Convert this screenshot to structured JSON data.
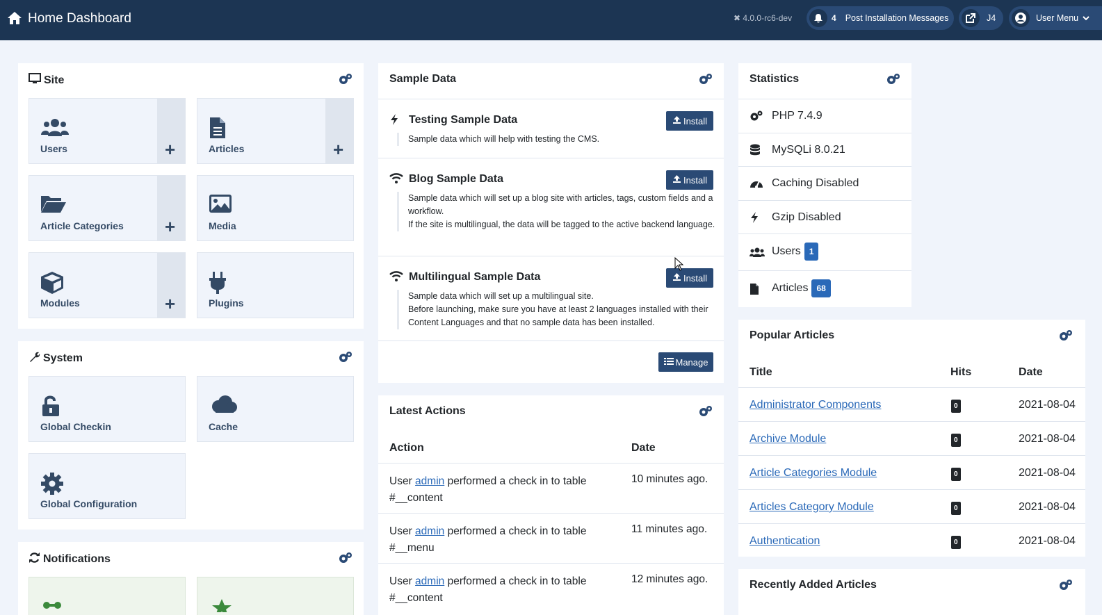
{
  "header": {
    "title": "Home Dashboard",
    "version": "4.0.0-rc6-dev",
    "notifications_count": "4",
    "post_install_label": "Post Installation Messages",
    "site_link_label": "J4",
    "user_menu_label": "User Menu"
  },
  "site": {
    "title": "Site",
    "tiles": [
      {
        "label": "Users",
        "icon": "users-icon"
      },
      {
        "label": "Articles",
        "icon": "file-icon"
      },
      {
        "label": "Article Categories",
        "icon": "folder-open-icon"
      },
      {
        "label": "Media",
        "icon": "image-icon"
      },
      {
        "label": "Modules",
        "icon": "cube-icon"
      },
      {
        "label": "Plugins",
        "icon": "plug-icon"
      }
    ]
  },
  "system": {
    "title": "System",
    "tiles": [
      {
        "label": "Global Checkin",
        "icon": "unlock-icon"
      },
      {
        "label": "Cache",
        "icon": "cloud-icon"
      },
      {
        "label": "Global Configuration",
        "icon": "cog-icon"
      }
    ]
  },
  "notifications": {
    "title": "Notifications"
  },
  "sample_data": {
    "title": "Sample Data",
    "install_label": "Install",
    "manage_label": "Manage",
    "items": [
      {
        "title": "Testing Sample Data",
        "desc1": "Sample data which will help with testing the CMS.",
        "desc2": ""
      },
      {
        "title": "Blog Sample Data",
        "desc1": "Sample data which will set up a blog site with articles, tags, custom fields and a workflow.",
        "desc2": "If the site is multilingual, the data will be tagged to the active backend language."
      },
      {
        "title": "Multilingual Sample Data",
        "desc1": "Sample data which will set up a multilingual site.",
        "desc2": "Before launching, make sure you have at least 2 languages installed with their Content Languages and that no sample data has been installed."
      }
    ]
  },
  "latest_actions": {
    "title": "Latest Actions",
    "col_action": "Action",
    "col_date": "Date",
    "rows": [
      {
        "pre": "User ",
        "user": "admin",
        "post": " performed a check in to table #__content",
        "date": "10 minutes ago."
      },
      {
        "pre": "User ",
        "user": "admin",
        "post": " performed a check in to table #__menu",
        "date": "11 minutes ago."
      },
      {
        "pre": "User ",
        "user": "admin",
        "post": " performed a check in to table #__content",
        "date": "12 minutes ago."
      }
    ]
  },
  "statistics": {
    "title": "Statistics",
    "rows": [
      {
        "label": "PHP 7.4.9",
        "icon": "cogs-icon"
      },
      {
        "label": "MySQLi 8.0.21",
        "icon": "database-icon"
      },
      {
        "label": "Caching Disabled",
        "icon": "tachometer-icon"
      },
      {
        "label": "Gzip Disabled",
        "icon": "bolt-icon"
      },
      {
        "label": "Users",
        "badge": "1",
        "icon": "users-icon"
      },
      {
        "label": "Articles",
        "badge": "68",
        "icon": "file-icon"
      }
    ]
  },
  "popular_articles": {
    "title": "Popular Articles",
    "col_title": "Title",
    "col_hits": "Hits",
    "col_date": "Date",
    "rows": [
      {
        "title": "Administrator Components",
        "hits": "0",
        "date": "2021-08-04"
      },
      {
        "title": "Archive Module",
        "hits": "0",
        "date": "2021-08-04"
      },
      {
        "title": "Article Categories Module",
        "hits": "0",
        "date": "2021-08-04"
      },
      {
        "title": "Articles Category Module",
        "hits": "0",
        "date": "2021-08-04"
      },
      {
        "title": "Authentication",
        "hits": "0",
        "date": "2021-08-04"
      }
    ]
  },
  "recently_added": {
    "title": "Recently Added Articles"
  },
  "colors": {
    "header_bg": "#1c3553",
    "accent": "#2a4a75",
    "link": "#2a69b8",
    "page_bg": "#f0f4fb"
  }
}
